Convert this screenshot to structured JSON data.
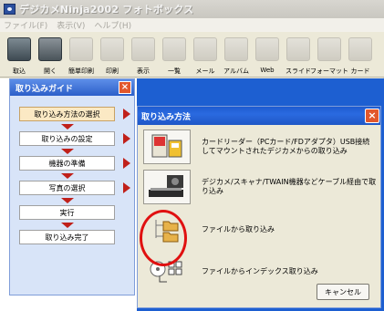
{
  "window": {
    "title": "デジカメNinja2002 フォトボックス"
  },
  "menubar": {
    "items": [
      "ファイル(F)",
      "表示(V)",
      "ヘルプ(H)"
    ]
  },
  "toolbar": {
    "items": [
      {
        "label": "取込",
        "icon": "camera-import-icon",
        "enabled": true
      },
      {
        "label": "開く",
        "icon": "open-camera-icon",
        "enabled": true
      },
      {
        "label": "簡単印刷",
        "icon": "easy-print-icon",
        "enabled": false
      },
      {
        "label": "印刷",
        "icon": "print-icon",
        "enabled": false
      },
      {
        "label": "表示",
        "icon": "view-icon",
        "enabled": false
      },
      {
        "label": "一覧",
        "icon": "list-icon",
        "enabled": false
      },
      {
        "label": "メール",
        "icon": "mail-icon",
        "enabled": false
      },
      {
        "label": "アルバム",
        "icon": "album-icon",
        "enabled": false
      },
      {
        "label": "Web",
        "icon": "web-icon",
        "enabled": false
      },
      {
        "label": "スライド",
        "icon": "slide-icon",
        "enabled": false
      },
      {
        "label": "フォーマット",
        "icon": "format-icon",
        "enabled": false
      },
      {
        "label": "カード",
        "icon": "card-icon",
        "enabled": false
      }
    ]
  },
  "guide": {
    "title": "取り込みガイド",
    "close": "×",
    "steps": [
      {
        "label": "取り込み方法の選択",
        "active": true,
        "arrow": true
      },
      {
        "label": "取り込みの設定",
        "active": false,
        "arrow": true
      },
      {
        "label": "機器の準備",
        "active": false,
        "arrow": true
      },
      {
        "label": "写真の選択",
        "active": false,
        "arrow": true
      },
      {
        "label": "実行",
        "active": false,
        "arrow": false
      },
      {
        "label": "取り込み完了",
        "active": false,
        "arrow": false
      }
    ]
  },
  "dialog": {
    "title": "取り込み方法",
    "close": "×",
    "options": [
      {
        "icon": "card-reader-icon",
        "desc": "カードリーダー（PCカード/FDアダプタ）USB接続してマウントされたデジカメからの取り込み"
      },
      {
        "icon": "scanner-twain-icon",
        "desc": "デジカメ/スキャナ/TWAIN機器などケーブル経由で取り込み"
      },
      {
        "icon": "folder-import-icon",
        "desc": "ファイルから取り込み"
      },
      {
        "icon": "index-import-icon",
        "desc": "ファイルからインデックス取り込み"
      }
    ],
    "cancel_label": "キャンセル"
  },
  "colors": {
    "desktop": "#1d5fd1",
    "title_bar": "#1f57c6",
    "highlight": "#e01010",
    "arrow": "#c0201a"
  }
}
